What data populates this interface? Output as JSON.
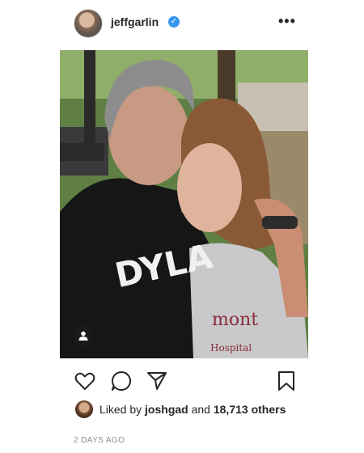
{
  "post": {
    "username": "jeffgarlin",
    "verified_symbol": "✓",
    "more_label": "•••",
    "photo_shirt_text": "DYLA",
    "photo_sweatshirt_text_1": "mont",
    "photo_sweatshirt_text_2": "Hospital"
  },
  "likes": {
    "prefix": "Liked by ",
    "user": "joshgad",
    "middle": " and ",
    "count": "18,713 others"
  },
  "timestamp": "2 DAYS AGO",
  "icons": {
    "like": "heart-icon",
    "comment": "comment-icon",
    "share": "share-icon",
    "save": "bookmark-icon",
    "tag": "user-tag-icon"
  },
  "colors": {
    "verified": "#3897f0",
    "text": "#262626",
    "muted": "#8e8e8e"
  }
}
